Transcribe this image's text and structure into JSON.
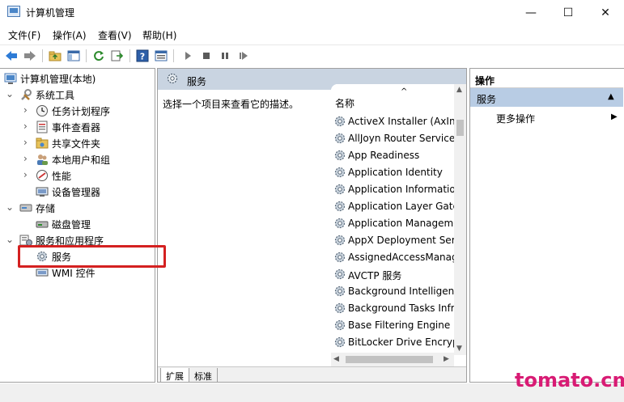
{
  "window": {
    "title": "计算机管理",
    "controls": {
      "minimize": "—",
      "maximize": "☐",
      "close": "✕"
    }
  },
  "menu": [
    "文件(F)",
    "操作(A)",
    "查看(V)",
    "帮助(H)"
  ],
  "toolbar": {
    "icons": [
      "back-arrow-icon",
      "forward-arrow-icon",
      "folder-up-icon",
      "show-hide-tree-icon",
      "refresh-icon",
      "export-list-icon",
      "help-icon",
      "properties-icon",
      "play-icon",
      "stop-icon",
      "pause-icon",
      "restart-icon"
    ]
  },
  "tree": {
    "root": "计算机管理(本地)",
    "system_tools": {
      "label": "系统工具",
      "children": [
        "任务计划程序",
        "事件查看器",
        "共享文件夹",
        "本地用户和组",
        "性能",
        "设备管理器"
      ]
    },
    "storage": {
      "label": "存储",
      "children": [
        "磁盘管理"
      ]
    },
    "services_apps": {
      "label": "服务和应用程序",
      "children": [
        "服务",
        "WMI 控件"
      ]
    }
  },
  "middle": {
    "header_title": "服务",
    "description": "选择一个项目来查看它的描述。",
    "column_name": "名称",
    "sort_indicator": "^",
    "services": [
      "ActiveX Installer (AxInstSV)",
      "AllJoyn Router Service",
      "App Readiness",
      "Application Identity",
      "Application Information",
      "Application Layer Gateway Service",
      "Application Management",
      "AppX Deployment Service (AppXSVC)",
      "AssignedAccessManager Service",
      "AVCTP 服务",
      "Background Intelligent Transfer Service",
      "Background Tasks Infrastructure Service",
      "Base Filtering Engine",
      "BitLocker Drive Encryption Service"
    ],
    "tabs": [
      "扩展",
      "标准"
    ]
  },
  "actions": {
    "title": "操作",
    "section": "服务",
    "more": "更多操作"
  },
  "watermark": "tomato.cm",
  "colors": {
    "header_bg": "#c9d4e1",
    "actions_section_bg": "#b8cce4",
    "highlight": "#d42020",
    "watermark": "#d81b74"
  }
}
